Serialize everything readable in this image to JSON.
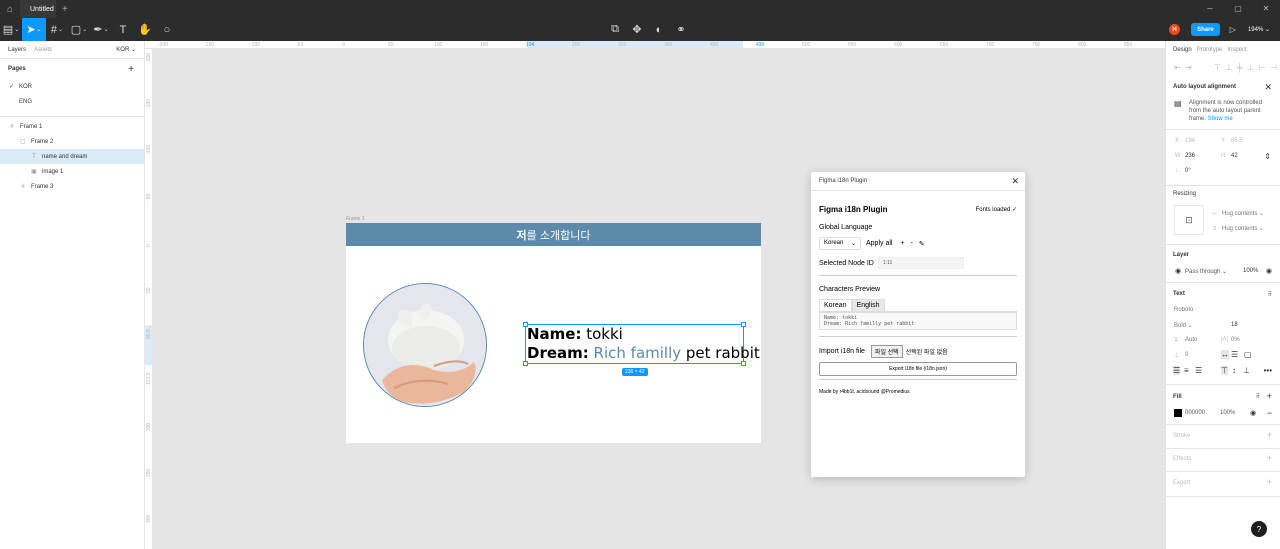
{
  "titlebar": {
    "tab_title": "Untitled",
    "new_tab": "+"
  },
  "toolbar": {
    "zoom": "194%",
    "share_label": "Share",
    "avatar_initial": "H"
  },
  "left_panel": {
    "tab_layers": "Layers",
    "tab_assets": "Assets",
    "page_selector": "KOR ⌄",
    "pages_title": "Pages",
    "pages": [
      "KOR",
      "ENG"
    ],
    "layers": [
      {
        "label": "Frame 1",
        "icon": "#"
      },
      {
        "label": "Frame 2",
        "icon": "▢"
      },
      {
        "label": "name and dream",
        "icon": "T"
      },
      {
        "label": "image 1",
        "icon": "▣"
      },
      {
        "label": "Frame 3",
        "icon": "#"
      }
    ]
  },
  "rulers": {
    "top": [
      "-200",
      "-150",
      "-100",
      "-50",
      "0",
      "50",
      "100",
      "150",
      "194",
      "250",
      "300",
      "350",
      "400",
      "430",
      "500",
      "550",
      "600",
      "650",
      "700",
      "750",
      "800",
      "850"
    ],
    "left": [
      "-200",
      "-150",
      "-100",
      "-50",
      "0",
      "50",
      "85.5",
      "127.5",
      "200",
      "250",
      "300"
    ]
  },
  "canvas": {
    "frame_label": "Frame 1",
    "header_bold": "저",
    "header_rest": "를 소개합니다",
    "name_label": "Name:",
    "name_value": " tokki",
    "dream_label": "Dream:",
    "dream_blue": " Rich familly",
    "dream_rest": " pet rabbit",
    "dim_badge": "236 × 42"
  },
  "plugin": {
    "window_title": "Figma i18n Plugin",
    "title": "Figma i18n Plugin",
    "fonts_loaded": "Fonts loaded ✓",
    "global_language_label": "Global Language",
    "language_value": "Korean",
    "apply_all": "Apply all",
    "selected_node_label": "Selected Node ID",
    "selected_node_value": "1:11",
    "characters_preview_label": "Characters Preview",
    "tab_korean": "Korean",
    "tab_english": "English",
    "preview_line1": "Name: tokki",
    "preview_line2": "Dream: Rich familly pet rabbit",
    "import_label": "Import i18n file",
    "file_button": "파일 선택",
    "file_status": "선택된 파일 없음",
    "export_button": "Export i18n file (i18n.json)",
    "credits": "Made by r4bb1t, acidsound @Promedius"
  },
  "right_panel": {
    "tab_design": "Design",
    "tab_prototype": "Prototype",
    "tab_inspect": "Inspect",
    "auto_layout_title": "Auto layout alignment",
    "auto_layout_note": "Alignment is now controlled from the auto layout parent frame.",
    "show_me": "Show me",
    "x_label": "X",
    "x_value": "194",
    "y_label": "Y",
    "y_value": "85.5",
    "w_label": "W",
    "w_value": "236",
    "h_label": "H",
    "h_value": "42",
    "rotation": "0°",
    "resizing_title": "Resizing",
    "hug_contents_1": "Hug contents",
    "hug_contents_2": "Hug contents",
    "layer_title": "Layer",
    "blend_mode": "Pass through",
    "layer_opacity": "100%",
    "text_title": "Text",
    "font_family": "Roboto",
    "font_weight": "Bold",
    "font_size": "18",
    "line_height": "Auto",
    "letter_spacing": "0%",
    "paragraph_spacing": "0",
    "fill_title": "Fill",
    "fill_hex": "000000",
    "fill_opacity": "100%",
    "stroke_title": "Stroke",
    "effects_title": "Effects",
    "export_title": "Export"
  },
  "help": "?"
}
